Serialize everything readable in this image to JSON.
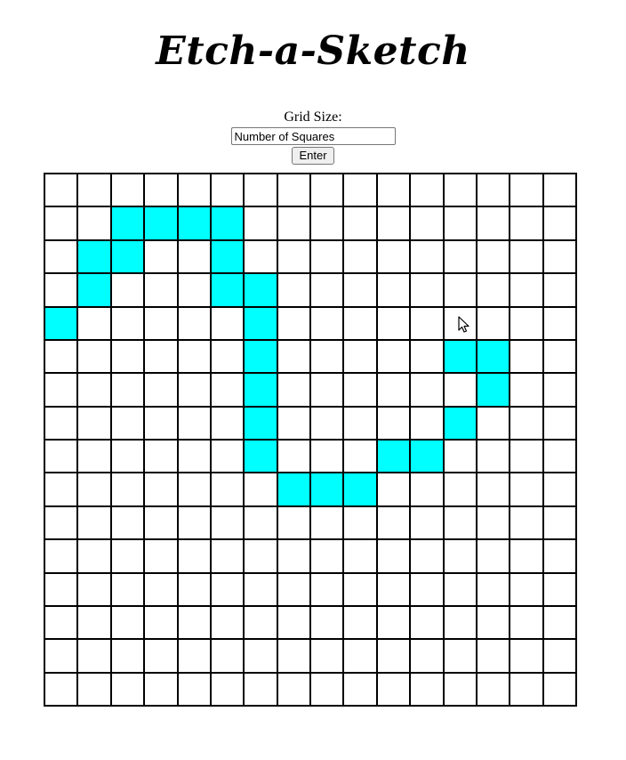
{
  "app": {
    "title": "Etch-a-Sketch"
  },
  "controls": {
    "label": "Grid Size:",
    "input_value": "Number of Squares",
    "button_label": "Enter"
  },
  "grid": {
    "size": 16,
    "fill_color": "#00ffff",
    "empty_color": "#ffffff",
    "filled_cells": [
      [
        1,
        2
      ],
      [
        1,
        3
      ],
      [
        1,
        4
      ],
      [
        1,
        5
      ],
      [
        2,
        1
      ],
      [
        2,
        2
      ],
      [
        2,
        5
      ],
      [
        3,
        1
      ],
      [
        3,
        5
      ],
      [
        3,
        6
      ],
      [
        4,
        0
      ],
      [
        4,
        6
      ],
      [
        5,
        6
      ],
      [
        5,
        12
      ],
      [
        5,
        13
      ],
      [
        6,
        6
      ],
      [
        6,
        13
      ],
      [
        7,
        6
      ],
      [
        7,
        12
      ],
      [
        8,
        6
      ],
      [
        8,
        10
      ],
      [
        8,
        11
      ],
      [
        9,
        7
      ],
      [
        9,
        8
      ],
      [
        9,
        9
      ]
    ]
  },
  "cursor": {
    "icon": "mouse-pointer-icon"
  }
}
